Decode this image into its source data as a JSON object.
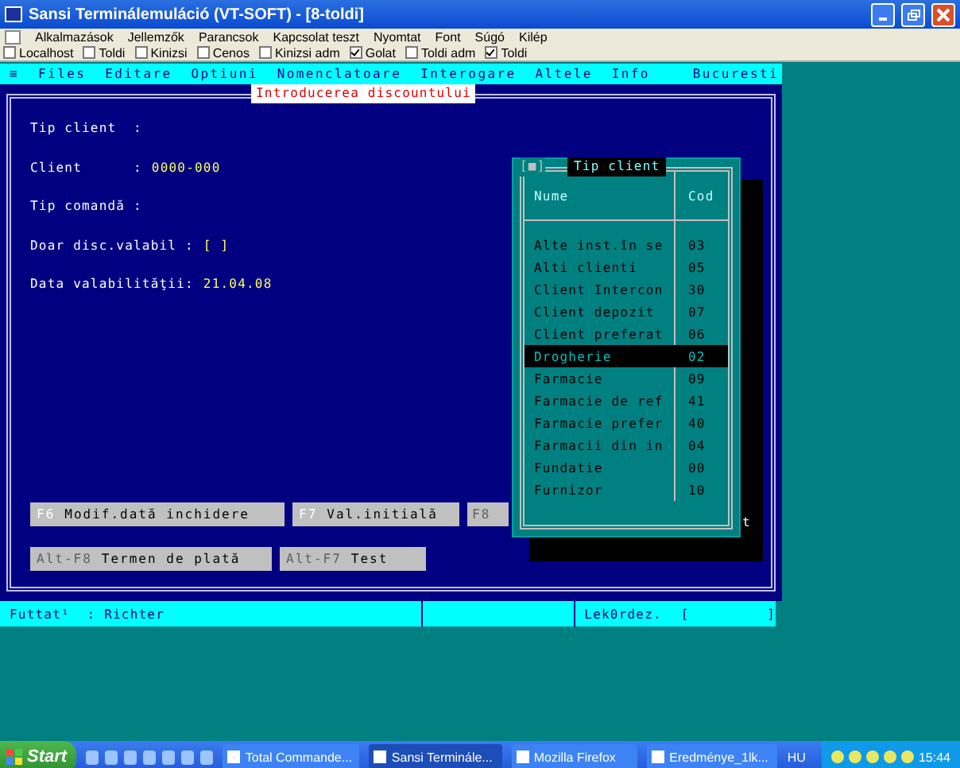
{
  "window": {
    "title": "Sansi Terminálemuláció (VT-SOFT) - [8-toldi]"
  },
  "menu": [
    "Alkalmazások",
    "Jellemzők",
    "Parancsok",
    "Kapcsolat teszt",
    "Nyomtat",
    "Font",
    "Súgó",
    "Kilép"
  ],
  "toolbar": [
    {
      "label": "Localhost",
      "checked": false
    },
    {
      "label": "Toldi",
      "checked": false
    },
    {
      "label": "Kinizsi",
      "checked": false
    },
    {
      "label": "Cenos",
      "checked": false
    },
    {
      "label": "Kinizsi adm",
      "checked": false
    },
    {
      "label": "Golat",
      "checked": true
    },
    {
      "label": "Toldi adm",
      "checked": false
    },
    {
      "label": "Toldi",
      "checked": true
    }
  ],
  "terminal": {
    "menu_icon": "≡",
    "menu": [
      "Files",
      "Editare",
      "Optiuni",
      "Nomenclatoare",
      "Interogare",
      "Altele",
      "Info"
    ],
    "location": "Bucuresti",
    "form_title": "Introducerea discountului",
    "fields": [
      {
        "label": "Tip client  :"
      },
      {
        "label": "Client      :",
        "value": "0000-000"
      },
      {
        "label": "Tip comandă :"
      },
      {
        "label": "Doar disc.valabil :",
        "value": "[ ]"
      },
      {
        "label": "Data valabilităţii:",
        "value": "21.04.08"
      }
    ],
    "buttons": [
      [
        {
          "key": "F6",
          "label": "Modif.dată inchidere",
          "disabled": false
        },
        {
          "key": "F7",
          "label": "Val.initială",
          "disabled": false
        },
        {
          "key": "F8",
          "disabled": true
        }
      ],
      [
        {
          "key": "Alt-F8",
          "label": "Termen de plată",
          "disabled": true
        },
        {
          "key": "Alt-F7",
          "label": "Test",
          "disabled": true
        }
      ]
    ],
    "hidden_text": "t",
    "popup": {
      "close": "[■]",
      "title": "Tip client",
      "columns": [
        "Nume",
        "Cod"
      ],
      "rows": [
        {
          "name": "Alte inst.în se",
          "code": "03",
          "selected": false
        },
        {
          "name": "Alti clienti",
          "code": "05",
          "selected": false
        },
        {
          "name": "Client Intercon",
          "code": "30",
          "selected": false
        },
        {
          "name": "Client depozit",
          "code": "07",
          "selected": false
        },
        {
          "name": "Client preferat",
          "code": "06",
          "selected": false
        },
        {
          "name": "Drogherie",
          "code": "02",
          "selected": true
        },
        {
          "name": "Farmacie",
          "code": "09",
          "selected": false
        },
        {
          "name": "Farmacie de ref",
          "code": "41",
          "selected": false
        },
        {
          "name": "Farmacie prefer",
          "code": "40",
          "selected": false
        },
        {
          "name": "Farmacii din in",
          "code": "04",
          "selected": false
        },
        {
          "name": "Fundatie",
          "code": "00",
          "selected": false
        },
        {
          "name": "Furnizor",
          "code": "10",
          "selected": false
        }
      ]
    },
    "status_bar": {
      "user": "Futtat¹  : Richter",
      "query": "Lek0rdez.",
      "query_field": "[         ]"
    }
  },
  "taskbar": {
    "start": "Start",
    "tasks": [
      {
        "label": "Total Commande...",
        "selected": false
      },
      {
        "label": "Sansi Terminále...",
        "selected": true
      },
      {
        "label": "Mozilla Firefox",
        "selected": false
      },
      {
        "label": "Eredménye_1lk...",
        "selected": false
      }
    ],
    "language": "HU",
    "clock": "15:44"
  }
}
